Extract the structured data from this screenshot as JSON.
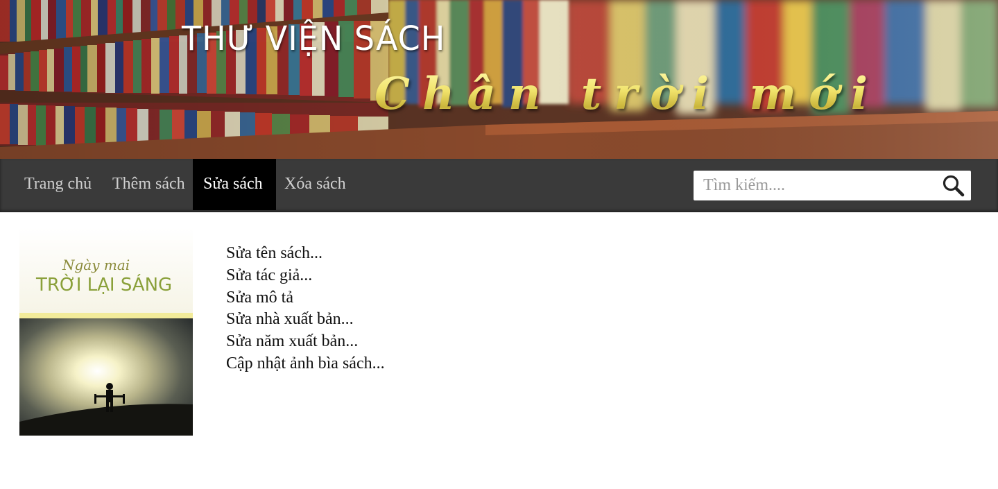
{
  "header": {
    "title": "THƯ VIỆN SÁCH",
    "slogan": "Chân trời mới"
  },
  "nav": {
    "items": [
      {
        "label": "Trang chủ",
        "active": false
      },
      {
        "label": "Thêm sách",
        "active": false
      },
      {
        "label": "Sửa sách",
        "active": true
      },
      {
        "label": "Xóa sách",
        "active": false
      }
    ]
  },
  "search": {
    "placeholder": "Tìm kiếm....",
    "value": "",
    "icon": "search-icon"
  },
  "book": {
    "cover_title_script": "Ngày mai",
    "cover_title": "TRỜI LẠI SÁNG"
  },
  "edit_menu": {
    "items": [
      "Sửa tên sách...",
      "Sửa tác giả...",
      "Sửa mô tả",
      "Sửa nhà xuất bản...",
      "Sửa năm xuất bản...",
      "Cập nhật ảnh bìa sách..."
    ]
  },
  "colors": {
    "nav_bg": "#3a3a3a",
    "nav_active_bg": "#000000",
    "nav_text": "#cfcfcf",
    "slogan_gold": "#f0e26a"
  }
}
